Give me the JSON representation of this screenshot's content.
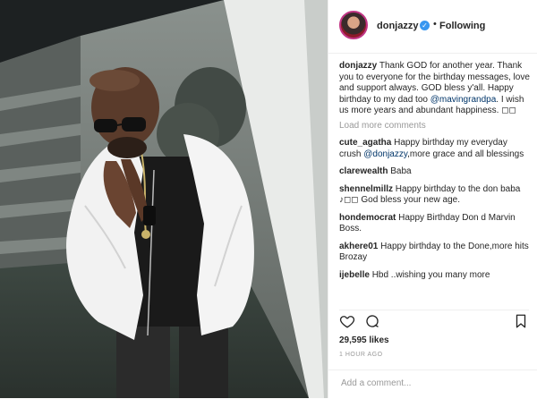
{
  "header": {
    "username": "donjazzy",
    "verified_glyph": "✓",
    "separator": "•",
    "follow_label": "Following"
  },
  "caption": {
    "username": "donjazzy",
    "text_1": "Thank GOD for another year. Thank you to everyone for the birthday messages, love and support always. GOD bless y'all. Happy birthday to my dad too",
    "mention": "@mavingrandpa",
    "text_2": ". I wish us more years and abundant happiness. ◻◻"
  },
  "load_more": "Load more comments",
  "comments": [
    {
      "user": "cute_agatha",
      "text_1": "Happy birthday my everyday crush",
      "mention": "@donjazzy",
      "text_2": ",more grace and all blessings"
    },
    {
      "user": "clarewealth",
      "text_1": "Baba",
      "mention": "",
      "text_2": ""
    },
    {
      "user": "shennelmillz",
      "text_1": "Happy birthday to the don baba ♪◻◻ God bless your new age.",
      "mention": "",
      "text_2": ""
    },
    {
      "user": "hondemocrat",
      "text_1": "Happy Birthday Don d Marvin Boss.",
      "mention": "",
      "text_2": ""
    },
    {
      "user": "akhere01",
      "text_1": "Happy birthday to the Done,more hits Brozay",
      "mention": "",
      "text_2": ""
    },
    {
      "user": "ijebelle",
      "text_1": "Hbd ..wishing you many more",
      "mention": "",
      "text_2": ""
    }
  ],
  "icons": {
    "like": "heart-icon",
    "comment": "comment-icon",
    "save": "bookmark-icon"
  },
  "likes": "29,595 likes",
  "timestamp": "1 HOUR AGO",
  "add_comment": {
    "placeholder": "Add a comment..."
  },
  "colors": {
    "accent": "#3897f0",
    "link": "#003569",
    "muted": "#999999",
    "jacket": "#f2f2f2"
  }
}
